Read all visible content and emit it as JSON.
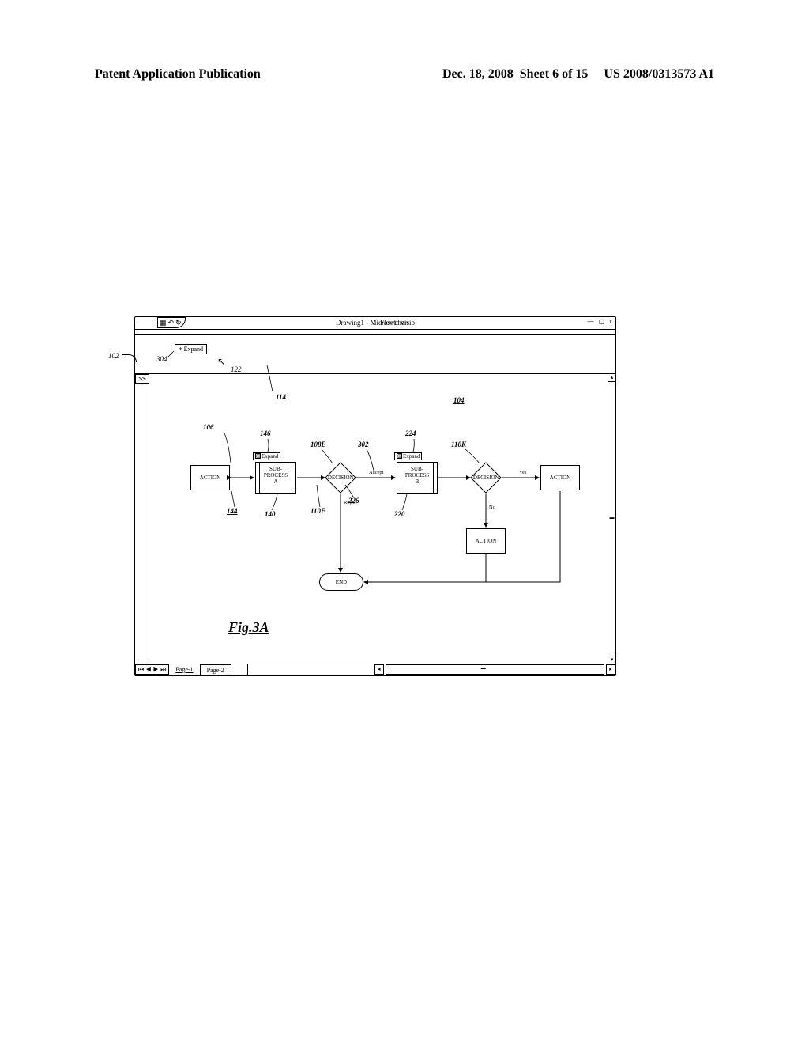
{
  "header": {
    "left": "Patent Application Publication",
    "date": "Dec. 18, 2008",
    "sheet": "Sheet 6 of 15",
    "pubno": "US 2008/0313573 A1"
  },
  "app": {
    "titlebar": {
      "doc_title": "Drawing1 - Microsoft Visio",
      "ribbon_label": "Flowchart",
      "minimize": "—",
      "maximize": "▢",
      "close": "x"
    },
    "ribbon": {
      "expand_label": "Expand"
    },
    "sidepanel": {
      "chev": ">>"
    },
    "pagetabs": {
      "nav": "⏮ ◀ ▶ ⏭",
      "p1": "Page-1",
      "p2": "Page-2"
    }
  },
  "labels": {
    "r102": "102",
    "r304": "304",
    "r122": "122",
    "r114": "114",
    "r104": "104",
    "r106": "106",
    "r146": "146",
    "r108E": "108E",
    "r302": "302",
    "r224": "224",
    "r110K": "110K",
    "r144": "144",
    "r140": "140",
    "r110F": "110F",
    "r226": "226",
    "r220": "220",
    "fig": "Fig.3A"
  },
  "shapes": {
    "action1": "ACTION",
    "subA": "SUB-\nPROCESS\nA",
    "expandA": "Expand",
    "dec1": "DECISION",
    "subB": "SUB-\nPROCESS\nB",
    "expandB": "Expand",
    "dec2": "DECISION",
    "action2": "ACTION",
    "action3": "ACTION",
    "end": "END",
    "accept": "Accept",
    "reject": "Reject",
    "yes": "Yes",
    "no": "No"
  }
}
